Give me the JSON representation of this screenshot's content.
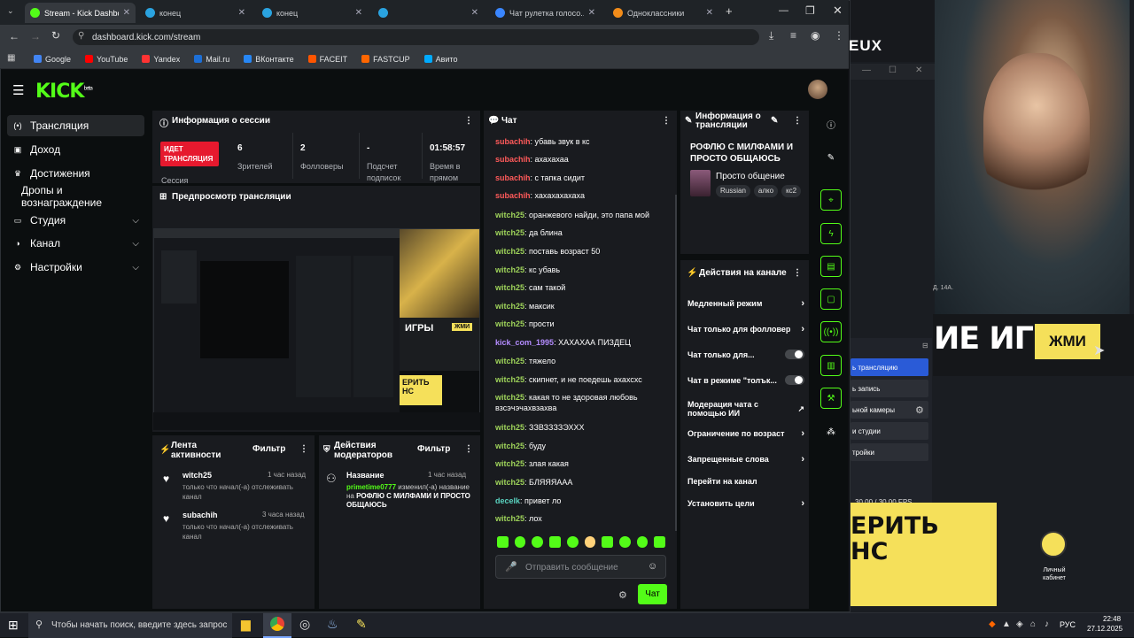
{
  "browser": {
    "tabs": [
      {
        "title": "Stream - Kick Dashboard",
        "active": true,
        "color": "#53fc18"
      },
      {
        "title": "конец",
        "active": false,
        "color": "#2aa3e0"
      },
      {
        "title": "конец",
        "active": false,
        "color": "#2aa3e0"
      },
      {
        "title": "",
        "active": false,
        "color": "#2aa3e0"
      },
      {
        "title": "Чат рулетка голосо...",
        "active": false,
        "color": "#3a86ff"
      },
      {
        "title": "Одноклассники",
        "active": false,
        "color": "#f28c1a"
      }
    ],
    "url": "dashboard.kick.com/stream",
    "bookmarks": [
      "Google",
      "YouTube",
      "Yandex",
      "Mail.ru",
      "ВКонтакте",
      "FACEIT",
      "FASTCUP",
      "Авито"
    ]
  },
  "kick": {
    "logo": "KICK",
    "logo_sup": "beta",
    "sidebar": [
      {
        "label": "Трансляция",
        "selected": true,
        "chev": false,
        "icon": "(•)"
      },
      {
        "label": "Доход",
        "selected": false,
        "chev": false,
        "icon": "▣"
      },
      {
        "label": "Достижения",
        "selected": false,
        "chev": false,
        "icon": "♛"
      },
      {
        "label": "Дропы и вознаграждение",
        "selected": false,
        "chev": false,
        "icon": ""
      },
      {
        "label": "Студия",
        "selected": false,
        "chev": true,
        "icon": "▭"
      },
      {
        "label": "Канал",
        "selected": false,
        "chev": true,
        "icon": "◑"
      },
      {
        "label": "Настройки",
        "selected": false,
        "chev": true,
        "icon": "⚙"
      }
    ],
    "session": {
      "title": "Информация о сессии",
      "live_badge": "ИДЕТ ТРАНСЛЯЦИЯ",
      "session_label": "Сессия",
      "stats": [
        {
          "value": "6",
          "label": "Зрителей"
        },
        {
          "value": "2",
          "label": "Фолловеры"
        },
        {
          "value": "-",
          "label": "Подсчет подписок"
        },
        {
          "value": "01:58:57",
          "label": "Время в прямом"
        }
      ]
    },
    "preview": {
      "title": "Предпросмотр трансляции",
      "overlay_text_1": "ИГРЫ",
      "overlay_text_2": "ЖМИ",
      "overlay_text_3": "ЕРИТЬ\nНС"
    },
    "activity": {
      "title": "Лента активности",
      "filter": "Фильтр",
      "items": [
        {
          "user": "witch25",
          "time": "1 час назад",
          "text": "только что начал(-а) отслеживать канал"
        },
        {
          "user": "subachih",
          "time": "3 часа назад",
          "text": "только что начал(-а) отслеживать канал"
        }
      ]
    },
    "mod_actions": {
      "title": "Действия модераторов",
      "filter": "Фильтр",
      "item": {
        "label": "Название",
        "time": "1 час назад",
        "user": "primetime0777",
        "changed": "изменил(-а)",
        "name_label": "название на",
        "new_title": "РОФЛЮ С МИЛФАМИ И ПРОСТО ОБЩАЮСЬ"
      }
    },
    "chat": {
      "title": "Чат",
      "messages": [
        {
          "user": "subachih",
          "text": "убавь звук в кс",
          "color": "#ff5a5a"
        },
        {
          "user": "subachih",
          "text": "ахахахаа",
          "color": "#ff5a5a"
        },
        {
          "user": "subachih",
          "text": "с тапка сидит",
          "color": "#ff5a5a"
        },
        {
          "user": "subachih",
          "text": "хахахахахаха",
          "color": "#ff5a5a"
        },
        {
          "user": "witch25",
          "text": "оранжевого найди, это папа мой",
          "color": "#9ed35a"
        },
        {
          "user": "witch25",
          "text": "да блина",
          "color": "#9ed35a"
        },
        {
          "user": "witch25",
          "text": "поставь возраст 50",
          "color": "#9ed35a"
        },
        {
          "user": "witch25",
          "text": "кс убавь",
          "color": "#9ed35a"
        },
        {
          "user": "witch25",
          "text": "сам такой",
          "color": "#9ed35a"
        },
        {
          "user": "witch25",
          "text": "максик",
          "color": "#9ed35a"
        },
        {
          "user": "witch25",
          "text": "прости",
          "color": "#9ed35a"
        },
        {
          "user": "kick_com_1995",
          "text": "ХАХАХАА ПИЗДЕЦ",
          "color": "#b48cff"
        },
        {
          "user": "witch25",
          "text": "тяжело",
          "color": "#9ed35a"
        },
        {
          "user": "witch25",
          "text": "скипнет, и не поедешь ахахсхс",
          "color": "#9ed35a"
        },
        {
          "user": "witch25",
          "text": "какая то не здоровая любовь",
          "color": "#9ed35a",
          "cont": "взсэчэчахвзахва"
        },
        {
          "user": "witch25",
          "text": "ЗЗВЗЗЗЗЭХХХ",
          "color": "#9ed35a"
        },
        {
          "user": "witch25",
          "text": "буду",
          "color": "#9ed35a"
        },
        {
          "user": "witch25",
          "text": "злая какая",
          "color": "#9ed35a"
        },
        {
          "user": "witch25",
          "text": "БЛЯЯЯААА",
          "color": "#9ed35a"
        },
        {
          "user": "decelk",
          "text": "привет ло",
          "color": "#5ad3c0"
        },
        {
          "user": "witch25",
          "text": "лох",
          "color": "#9ed35a"
        }
      ],
      "input_placeholder": "Отправить сообщение",
      "send_label": "Чат"
    },
    "stream_info": {
      "title": "Информация о трансляции",
      "stream_title": "РОФЛЮ С МИЛФАМИ И ПРОСТО ОБЩАЮСЬ",
      "category": "Просто общение",
      "tags": [
        "Russian",
        "алко",
        "кс2"
      ]
    },
    "channel_actions": {
      "title": "Действия на канале",
      "items": [
        {
          "label": "Медленный режим",
          "kind": "arrow"
        },
        {
          "label": "Чат только для фолловер",
          "kind": "arrow"
        },
        {
          "label": "Чат только для...",
          "kind": "toggle"
        },
        {
          "label": "Чат в режиме \"толък...",
          "kind": "toggle"
        },
        {
          "label": "Модерация чата с помощью ИИ",
          "kind": "ext"
        },
        {
          "label": "Ограничение по возраст",
          "kind": "arrow"
        },
        {
          "label": "Запрещенные слова",
          "kind": "arrow"
        },
        {
          "label": "Перейти на канал",
          "kind": "none"
        },
        {
          "label": "Установить цели",
          "kind": "arrow"
        }
      ]
    }
  },
  "obs": {
    "brand_text": "EUX",
    "banner_text": "ИЕ ИГРЫ",
    "button_text": "ЖМИ",
    "menu": [
      "ь трансляцию",
      "ь запись",
      "ьной камеры",
      "и студии",
      "тройки"
    ],
    "fps": "30.00 / 30.00 FPS",
    "yellow_text": "ЕРИТЬ\nНС",
    "desktop_icon_label": "Личный кабинет",
    "small_label": "Д. 14А."
  },
  "taskbar": {
    "search_placeholder": "Чтобы начать поиск, введите здесь запрос",
    "lang": "РУС",
    "time": "22:48",
    "date": "27.12.2025"
  }
}
